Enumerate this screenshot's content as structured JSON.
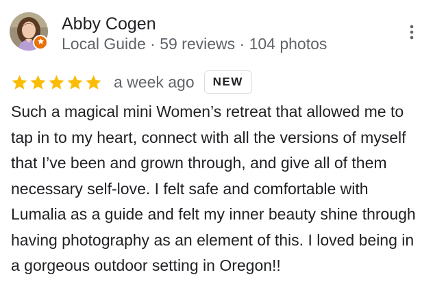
{
  "reviewer": {
    "name": "Abby Cogen",
    "meta": "Local Guide · 59 reviews · 104 photos",
    "badge_color": "#e8710a"
  },
  "review": {
    "rating": 5,
    "rating_max": 5,
    "star_color": "#fbbc04",
    "date": "a week ago",
    "badge": "NEW",
    "text": "Such a magical mini Women’s retreat that allowed me to tap in to my heart, connect with all the versions of myself that I’ve been and grown through, and give all of them necessary self-love. I felt safe and comfortable with Lumalia as a guide and felt my inner beauty shine through having photography as an element of this. I loved being in a gorgeous outdoor setting in Oregon!!"
  },
  "icons": {
    "more": "more-vert-icon",
    "star": "star-icon",
    "local_guide": "local-guide-star-icon"
  }
}
